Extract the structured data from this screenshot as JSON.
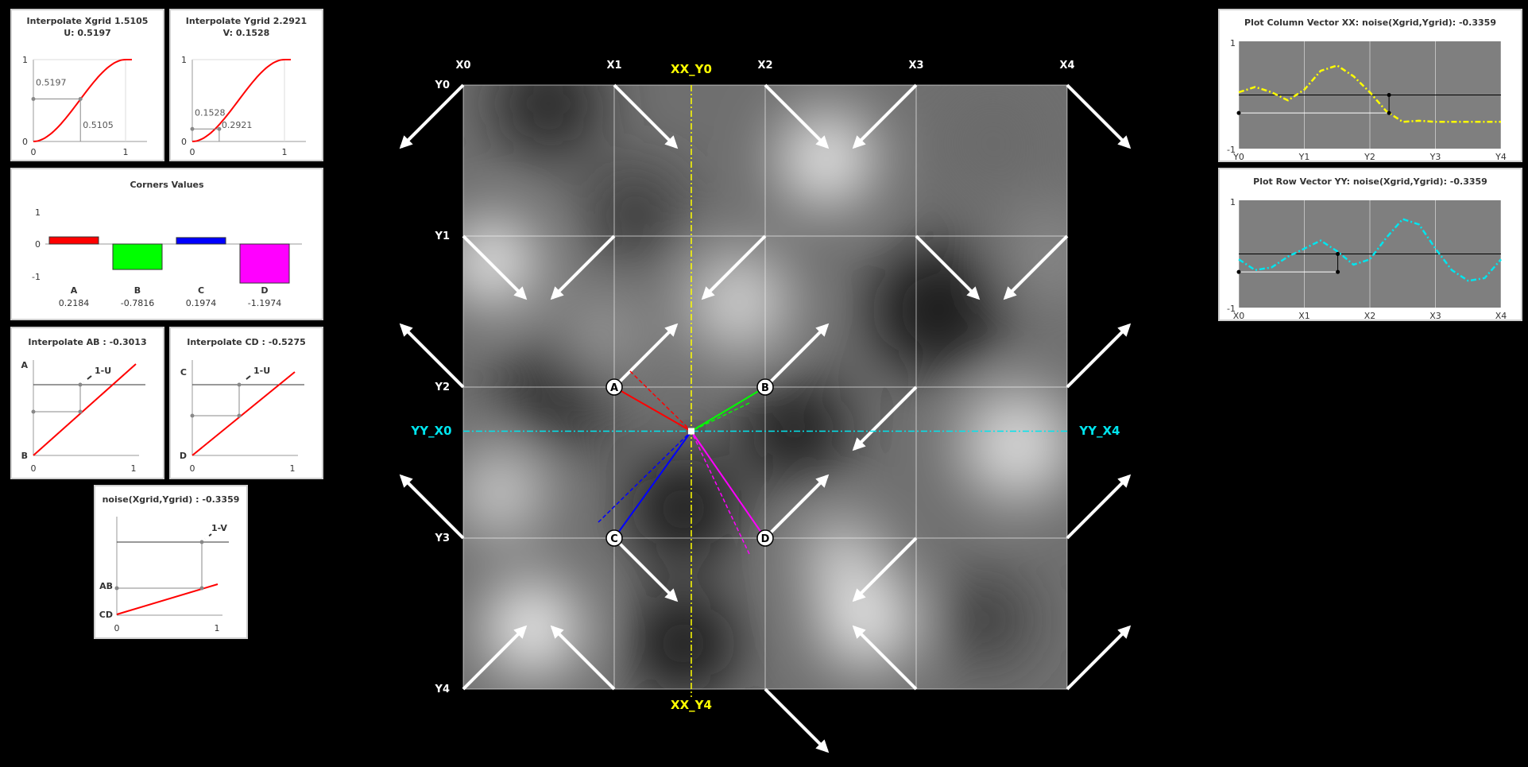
{
  "colors": {
    "background": "#000000",
    "curve_red": "#ff0000",
    "corner_a": "#ff0000",
    "corner_b": "#00ff00",
    "corner_c": "#0000ff",
    "corner_d": "#ff00ff",
    "xx_line": "#ffff00",
    "yy_line": "#00e5ee",
    "plot_bg": "#7f7f7f",
    "grid_line": "#ffffff"
  },
  "panels": {
    "interp_x": {
      "title_line1": "Interpolate Xgrid 1.5105",
      "title_line2": "U: 0.5197",
      "u_value": 0.5197,
      "frac_value": 0.5105,
      "u_label": "0.5197",
      "frac_label": "0.5105",
      "tick_0": "0",
      "tick_1": "1",
      "tick_1x": "1"
    },
    "interp_y": {
      "title_line1": "Interpolate Ygrid 2.2921",
      "title_line2": "V: 0.1528",
      "v_value": 0.1528,
      "frac_value": 0.2921,
      "v_label": "0.1528",
      "frac_label": "0.2921",
      "tick_0": "0",
      "tick_1": "1",
      "tick_1x": "1"
    },
    "corners": {
      "title": "Corners Values",
      "ticks": [
        "1",
        "0",
        "-1"
      ],
      "bars": [
        {
          "name": "A",
          "value": 0.2184,
          "value_label": "0.2184",
          "color": "#ff0000"
        },
        {
          "name": "B",
          "value": -0.7816,
          "value_label": "-0.7816",
          "color": "#00ff00"
        },
        {
          "name": "C",
          "value": 0.1974,
          "value_label": "0.1974",
          "color": "#0000ff"
        },
        {
          "name": "D",
          "value": -1.1974,
          "value_label": "-1.1974",
          "color": "#ff00ff"
        }
      ]
    },
    "interp_ab": {
      "title": "Interpolate AB : -0.3013",
      "top_label": "A",
      "bottom_label": "B",
      "marker": "1-U",
      "tick_0": "0",
      "tick_1": "1"
    },
    "interp_cd": {
      "title": "Interpolate CD : -0.5275",
      "top_label": "C",
      "bottom_label": "D",
      "marker": "1-U",
      "tick_0": "0",
      "tick_1": "1"
    },
    "noise": {
      "title": "noise(Xgrid,Ygrid) : -0.3359",
      "label_ab": "AB",
      "label_cd": "CD",
      "marker": "1-V",
      "tick_0": "0",
      "tick_1": "1"
    },
    "column_plot": {
      "title": "Plot Column Vector XX: noise(Xgrid,Ygrid): -0.3359",
      "y_top": "1",
      "y_bottom": "-1",
      "x_ticks": [
        "Y0",
        "Y1",
        "Y2",
        "Y3",
        "Y4"
      ]
    },
    "row_plot": {
      "title": "Plot Row Vector YY: noise(Xgrid,Ygrid): -0.3359",
      "y_top": "1",
      "y_bottom": "-1",
      "x_ticks": [
        "X0",
        "X1",
        "X2",
        "X3",
        "X4"
      ]
    }
  },
  "grid": {
    "x_labels": [
      "X0",
      "X1",
      "X2",
      "X3",
      "X4"
    ],
    "y_labels": [
      "Y0",
      "Y1",
      "Y2",
      "Y3",
      "Y4"
    ],
    "xx_top_label": "XX_Y0",
    "xx_bottom_label": "XX_Y4",
    "yy_left_label": "YY_X0",
    "yy_right_label": "YY_X4",
    "corner_labels": [
      "A",
      "B",
      "C",
      "D"
    ],
    "xgrid": 1.5105,
    "ygrid": 2.2921
  },
  "chart_data": [
    {
      "type": "line",
      "title": "Plot Column Vector XX: noise(Xgrid,Ygrid): -0.3359",
      "x_ticks": [
        "Y0",
        "Y1",
        "Y2",
        "Y3",
        "Y4"
      ],
      "ylim": [
        -1,
        1
      ],
      "x": [
        0,
        0.25,
        0.5,
        0.75,
        1,
        1.25,
        1.5,
        1.75,
        2,
        2.25,
        2.5,
        2.75,
        3,
        3.5,
        4
      ],
      "values": [
        0.05,
        0.15,
        0.05,
        -0.1,
        0.1,
        0.45,
        0.55,
        0.35,
        0.05,
        -0.3,
        -0.5,
        -0.48,
        -0.5,
        -0.5,
        -0.5
      ]
    },
    {
      "type": "line",
      "title": "Plot Row Vector YY: noise(Xgrid,Ygrid): -0.3359",
      "x_ticks": [
        "X0",
        "X1",
        "X2",
        "X3",
        "X4"
      ],
      "ylim": [
        -1,
        1
      ],
      "x": [
        0,
        0.25,
        0.5,
        0.75,
        1,
        1.25,
        1.5,
        1.75,
        2,
        2.25,
        2.5,
        2.75,
        3,
        3.25,
        3.5,
        3.75,
        4
      ],
      "values": [
        -0.1,
        -0.3,
        -0.25,
        -0.05,
        0.1,
        0.25,
        0.05,
        -0.2,
        -0.1,
        0.3,
        0.65,
        0.55,
        0.1,
        -0.3,
        -0.5,
        -0.45,
        -0.1
      ]
    }
  ]
}
